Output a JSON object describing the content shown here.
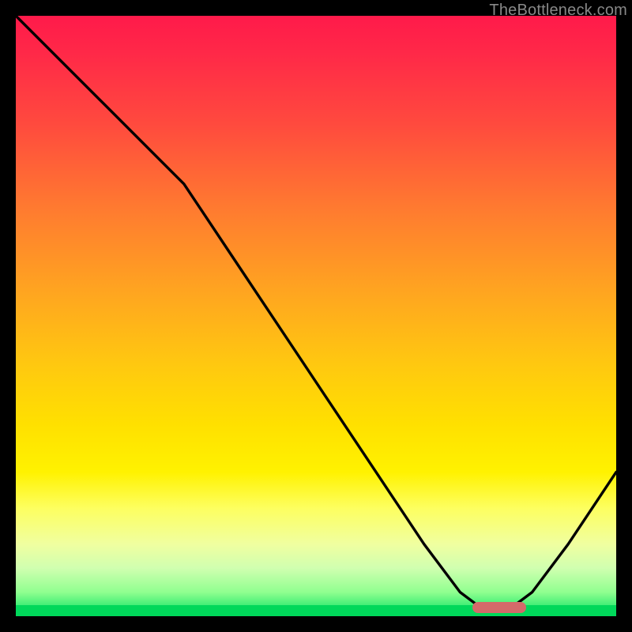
{
  "watermark": "TheBottleneck.com",
  "chart_data": {
    "type": "line",
    "title": "",
    "xlabel": "",
    "ylabel": "",
    "xlim": [
      0,
      100
    ],
    "ylim": [
      0,
      100
    ],
    "series": [
      {
        "name": "curve",
        "x": [
          0,
          8,
          16,
          24,
          28,
          36,
          44,
          52,
          60,
          68,
          74,
          78,
          82,
          86,
          92,
          100
        ],
        "y": [
          100,
          92,
          84,
          76,
          72,
          60,
          48,
          36,
          24,
          12,
          4,
          1,
          1,
          4,
          12,
          24
        ]
      }
    ],
    "marker": {
      "x_start": 76,
      "x_end": 85,
      "y": 0
    },
    "gradient_stops": [
      {
        "pct": 0,
        "color": "#ff1a4a"
      },
      {
        "pct": 18,
        "color": "#ff4a3e"
      },
      {
        "pct": 46,
        "color": "#ffa520"
      },
      {
        "pct": 68,
        "color": "#ffe000"
      },
      {
        "pct": 88,
        "color": "#f0ffa0"
      },
      {
        "pct": 100,
        "color": "#00e060"
      }
    ]
  }
}
